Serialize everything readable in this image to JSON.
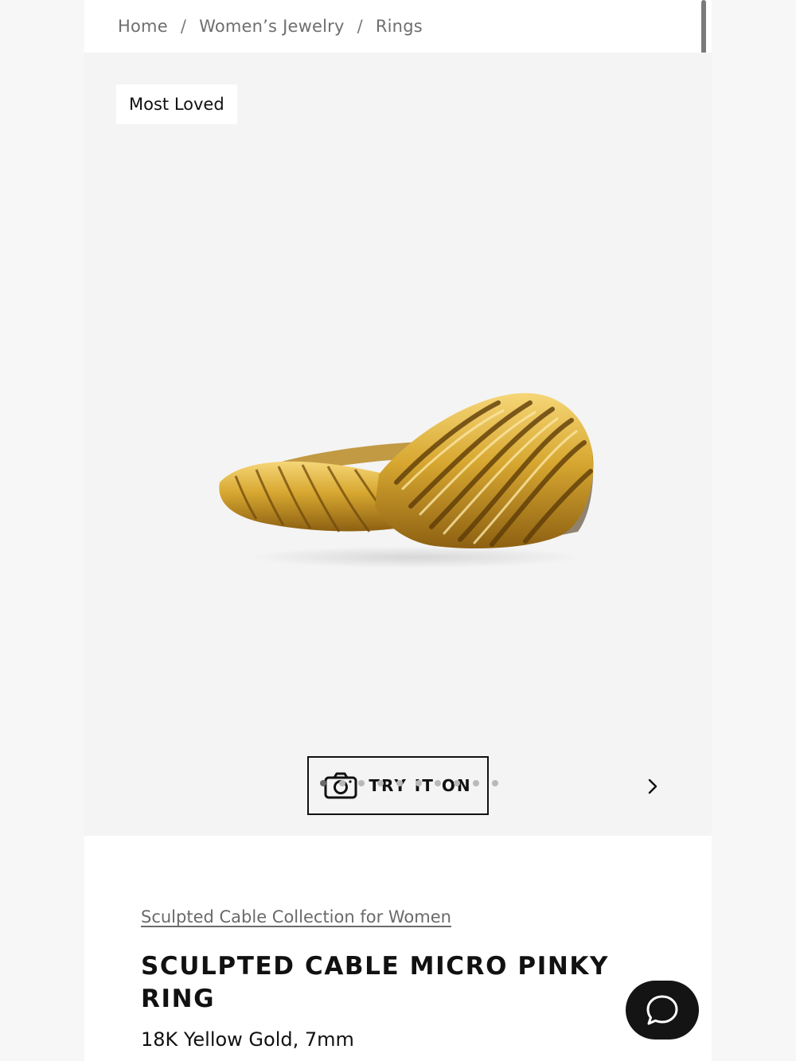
{
  "breadcrumb": {
    "items": [
      "Home",
      "Women’s Jewelry",
      "Rings"
    ],
    "separator": "/"
  },
  "gallery": {
    "badge": "Most Loved",
    "try_on_label": "TRY IT ON",
    "try_on_icon": "camera-icon",
    "next_icon": "chevron-right-icon",
    "slide_count": 10,
    "active_slide": 1
  },
  "product": {
    "collection_link": "Sculpted Cable Collection for Women",
    "title": "SCULPTED CABLE MICRO PINKY RING",
    "variant": "18K Yellow Gold, 7mm"
  },
  "chat": {
    "icon": "chat-bubble-icon"
  },
  "colors": {
    "gold": "#d9a932",
    "gold_dark": "#8a5f12",
    "chat_bg": "#141414"
  }
}
